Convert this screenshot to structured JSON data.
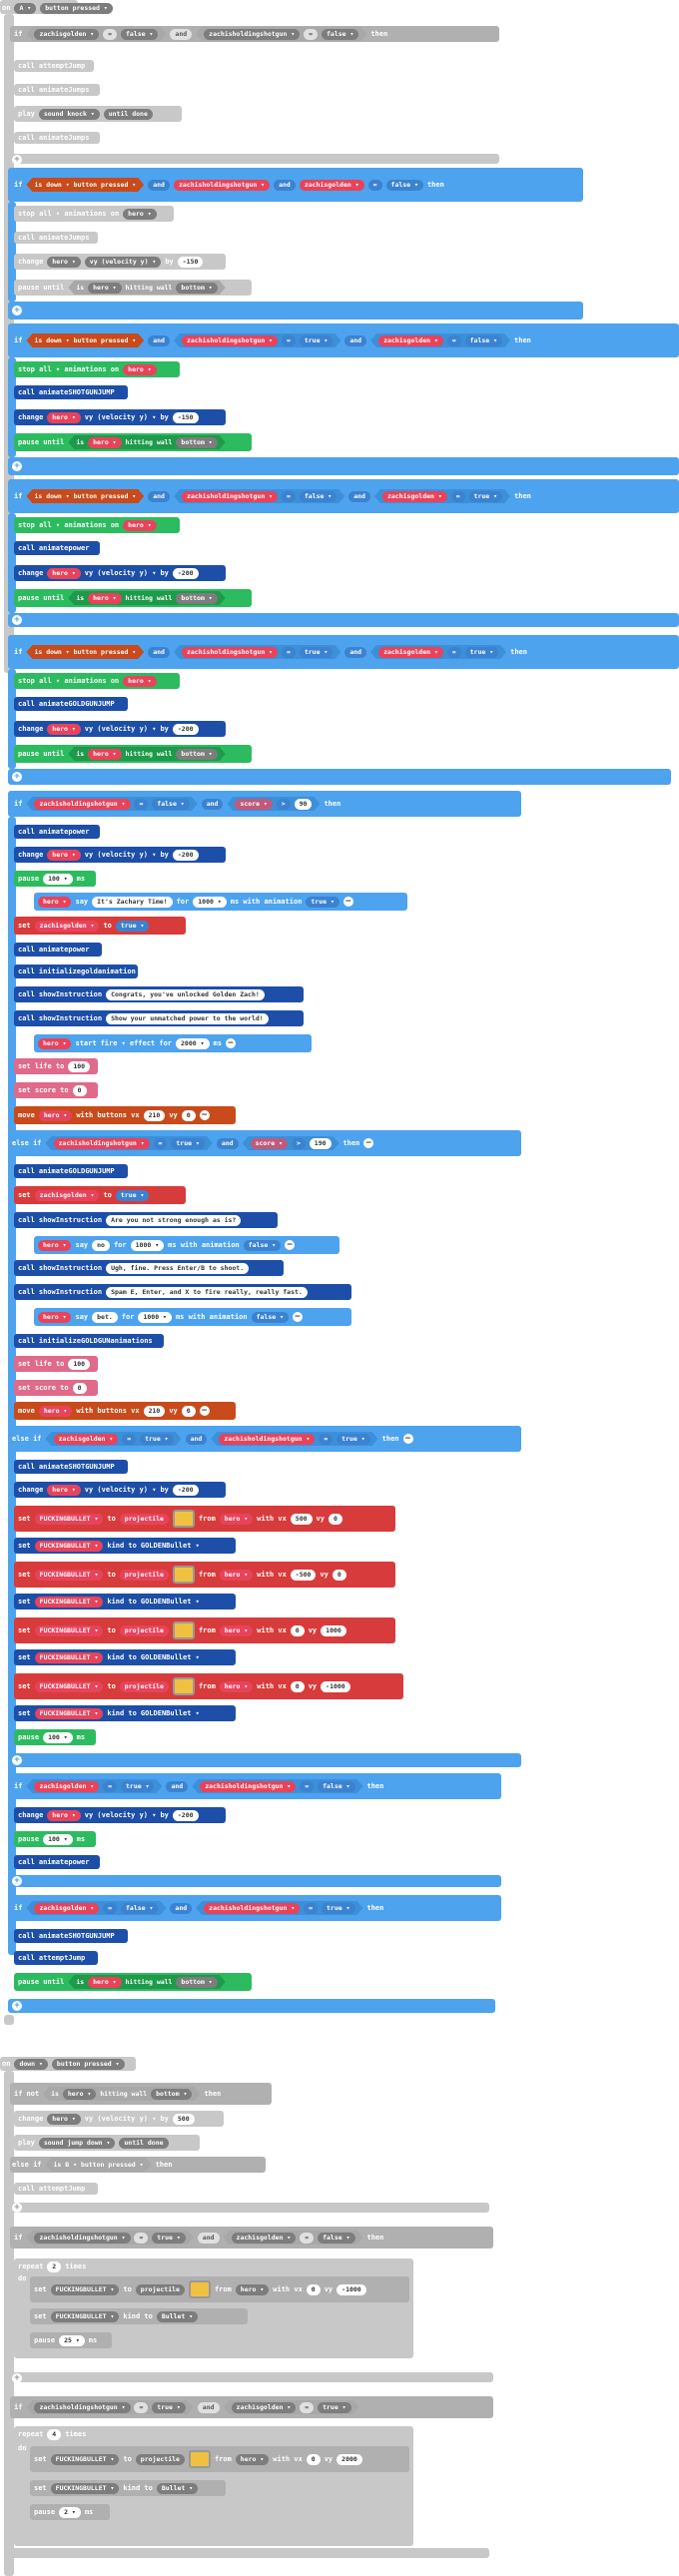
{
  "labels": {
    "on": "on",
    "if": "if",
    "then": "then",
    "else_if": "else if",
    "and": "and",
    "eq": "=",
    "gt": ">",
    "call": "call",
    "play": "play",
    "until_done": "until done",
    "stop_all_animations_on": "stop all ▾ animations on",
    "change": "change",
    "by": "by",
    "vy_velocity": "vy (velocity y) ▾",
    "pause_until": "pause until",
    "is": "is",
    "hitting_wall": "hitting wall",
    "bottom": "bottom ▾",
    "button_pressed": "button pressed ▾",
    "pause": "pause",
    "ms": "ms",
    "say": "say",
    "for": "for",
    "ms_with_animation": "ms with animation",
    "set": "set",
    "to": "to",
    "start": "start",
    "effect_for": "effect for",
    "move": "move",
    "with_buttons_vx": "with buttons vx",
    "vy": "vy",
    "projectile": "projectile",
    "from": "from",
    "with_vx": "with vx",
    "kind_to": "kind to",
    "repeat": "repeat",
    "times": "times",
    "do": "do",
    "not": "not",
    "else_if_is": "else if",
    "set_life_to": "set life to",
    "set_score_to": "set score to"
  },
  "vars": {
    "A": "A ▾",
    "B": "B ▾",
    "down": "down ▾",
    "zachisgolden": "zachisgolden ▾",
    "zachisholdingshotgun": "zachisholdingshotgun ▾",
    "hero": "hero ▾",
    "false": "false ▾",
    "true": "true ▾",
    "score": "score ▾",
    "FUCKINGBULLET": "FUCKINGBULLET ▾",
    "GOLDENBullet": "GOLDENBullet ▾",
    "Bullet": "Bullet ▾",
    "fire": "fire ▾"
  },
  "functions": {
    "attemptJump": "attemptJump",
    "animateJumps": "animateJumps",
    "animateSHOTGUNJUMP": "animateSHOTGUNJUMP",
    "animateGOLDGUNJUMP": "animateGOLDGUNJUMP",
    "animatepower": "animatepower",
    "initializegoldanimation": "initializegoldanimation",
    "showInstruction": "showInstruction",
    "initializeGOLDGUNanimations": "initializeGOLDGUNanimations",
    "animateShotgunjump": "animateSHOTGUNJUMP"
  },
  "sounds": {
    "knock": "sound knock ▾",
    "jump_down": "sound jump down ▾"
  },
  "values": {
    "v150": "-150",
    "v200": "-200",
    "v100": "100 ▾",
    "v1000": "1000 ▾",
    "v2000": "2000 ▾",
    "v210": "210",
    "v0": "0",
    "v100n": "100",
    "v90": "90",
    "v190": "190",
    "v500": "500",
    "vm500": "-500",
    "vm1000": "-1000",
    "v1000n": "1000",
    "v2": "2",
    "v4": "4",
    "v25": "25 ▾",
    "v2ms": "2 ▾",
    "v2000n": "2000"
  },
  "texts": {
    "zachary": "It's Zachary Time!",
    "congrats": "Congrats, you've unlocked Golden Zach!",
    "show_power": "Show your unmatched power to the world!",
    "not_strong": "Are you not strong enough as is?",
    "no": "no",
    "ugh": "Ugh, fine. Press Enter/B to shoot.",
    "spam": "Spam E, Enter, and X to fire really, really fast.",
    "bet": "bet."
  }
}
